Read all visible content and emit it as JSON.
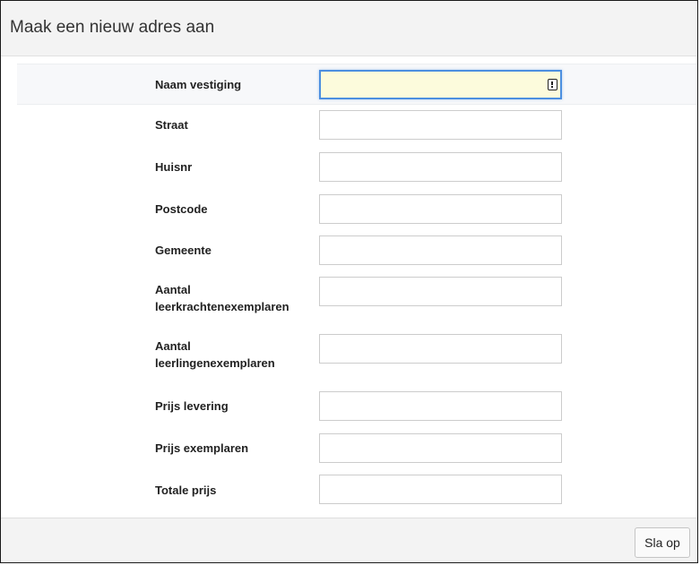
{
  "modal": {
    "title": "Maak een nieuw adres aan"
  },
  "form": {
    "fields": [
      {
        "label": "Naam vestiging",
        "value": "",
        "focused": true,
        "autofill_icon": "autofill-contact-icon"
      },
      {
        "label": "Straat",
        "value": ""
      },
      {
        "label": "Huisnr",
        "value": ""
      },
      {
        "label": "Postcode",
        "value": ""
      },
      {
        "label": "Gemeente",
        "value": ""
      },
      {
        "label": "Aantal leerkrachtenexemplaren",
        "label_line1": "Aantal",
        "label_line2": "leerkrachtenexemplaren",
        "value": ""
      },
      {
        "label": "Aantal leerlingenexemplaren",
        "label_line1": "Aantal",
        "label_line2": "leerlingenexemplaren",
        "value": ""
      },
      {
        "label": "Prijs levering",
        "value": ""
      },
      {
        "label": "Prijs exemplaren",
        "value": ""
      },
      {
        "label": "Totale prijs",
        "value": ""
      }
    ]
  },
  "footer": {
    "save_label": "Sla op"
  },
  "colors": {
    "focus_border": "#4c8fe0",
    "focus_fill": "#fcfbdc",
    "header_bg": "#f3f3f3"
  }
}
